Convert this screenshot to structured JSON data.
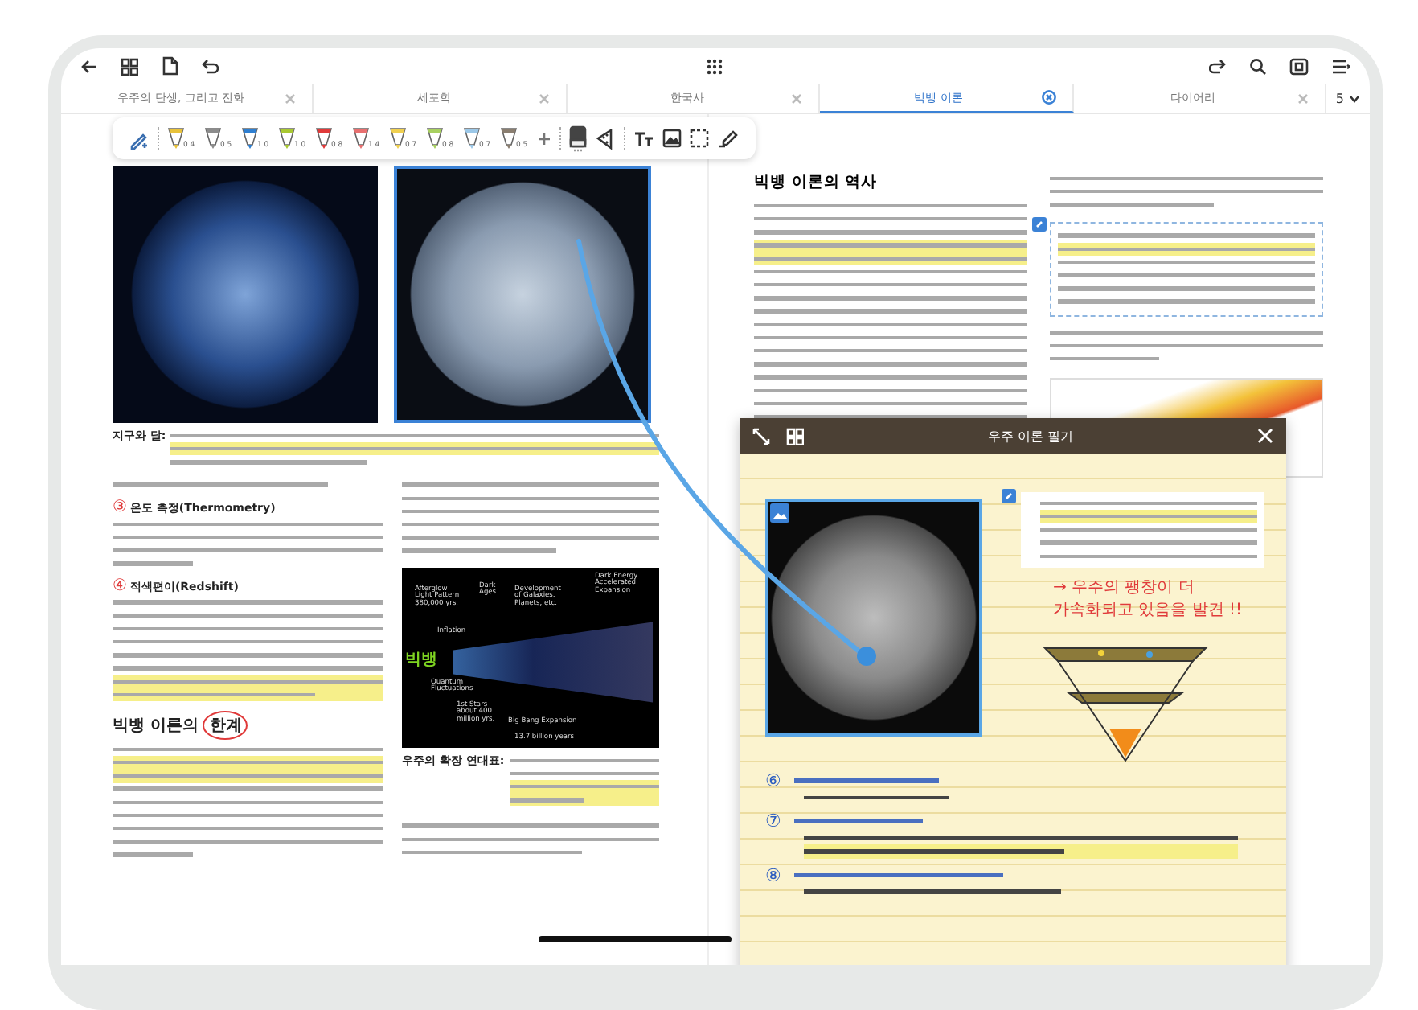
{
  "tabs": [
    {
      "label": "우주의 탄생, 그리고 진화",
      "selected": false
    },
    {
      "label": "세포학",
      "selected": false
    },
    {
      "label": "한국사",
      "selected": false
    },
    {
      "label": "빅뱅 이론",
      "selected": true
    },
    {
      "label": "다이어리",
      "selected": false
    }
  ],
  "tab_count": "5",
  "toolbar": {
    "pens": [
      {
        "size": "0.4",
        "color": "#e8c23a"
      },
      {
        "size": "0.5",
        "color": "#8c8c8c"
      },
      {
        "size": "1.0",
        "color": "#2f7fd0"
      },
      {
        "size": "1.0",
        "color": "#a9c832"
      },
      {
        "size": "0.8",
        "color": "#e03a3a"
      },
      {
        "size": "1.4",
        "color": "#e87070"
      },
      {
        "size": "0.7",
        "color": "#f0d050"
      },
      {
        "size": "0.8",
        "color": "#a8d060"
      },
      {
        "size": "0.7",
        "color": "#9cc8e8"
      },
      {
        "size": "0.5",
        "color": "#8a7e70"
      }
    ]
  },
  "left_page": {
    "figure_caption": "지구와 달:",
    "sections": [
      {
        "number": "③",
        "title": "온도 측정(Thermometry)"
      },
      {
        "number": "④",
        "title": "적색편이(Redshift)"
      }
    ],
    "heading": {
      "text": "빅뱅 이론의",
      "circled": "한계"
    },
    "timeline": {
      "annotation": "빅뱅",
      "labels": [
        "Afterglow Light Pattern 380,000 yrs.",
        "Dark Ages",
        "Development of Galaxies, Planets, etc.",
        "Dark Energy Accelerated Expansion",
        "Inflation",
        "Quantum Fluctuations",
        "1st Stars about 400 million yrs.",
        "Big Bang Expansion",
        "13.7 billion years"
      ]
    },
    "timeline_caption": "우주의 확장 연대표:"
  },
  "right_page": {
    "heading": "빅뱅 이론의 역사"
  },
  "note_window": {
    "title": "우주 이론 필기",
    "red_note": [
      "→ 우주의 팽창이 더",
      "가속화되고 있음을 발견 !!"
    ],
    "items": [
      {
        "number": "⑥"
      },
      {
        "number": "⑦"
      },
      {
        "number": "⑧"
      }
    ]
  }
}
